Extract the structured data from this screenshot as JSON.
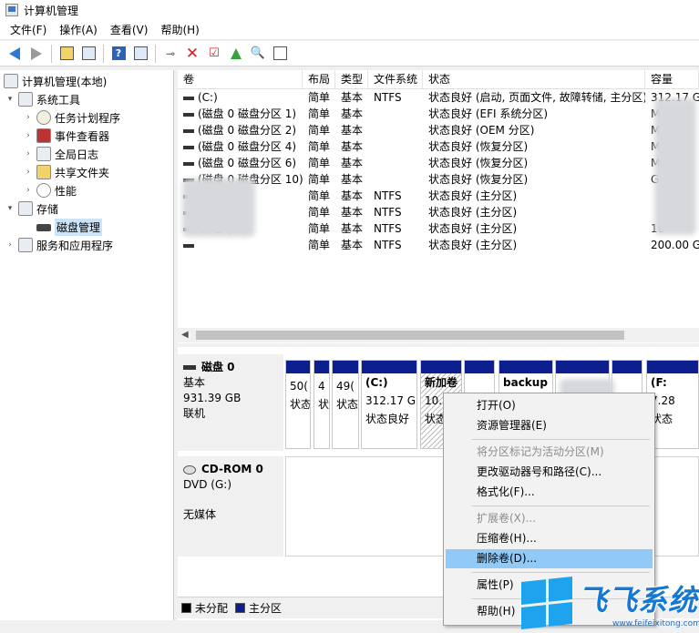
{
  "window": {
    "title": "计算机管理"
  },
  "menu": [
    "文件(F)",
    "操作(A)",
    "查看(V)",
    "帮助(H)"
  ],
  "tree": {
    "root": "计算机管理(本地)",
    "system_tools": "系统工具",
    "task_scheduler": "任务计划程序",
    "event_viewer": "事件查看器",
    "shared_folders_log": "全局日志",
    "shared_folders": "共享文件夹",
    "performance": "性能",
    "storage": "存储",
    "disk_management": "磁盘管理",
    "services": "服务和应用程序"
  },
  "volume_table": {
    "headers": [
      "卷",
      "布局",
      "类型",
      "文件系统",
      "状态",
      "容量"
    ],
    "rows": [
      {
        "vol": "(C:)",
        "layout": "简单",
        "type": "基本",
        "fs": "NTFS",
        "status": "状态良好 (启动, 页面文件, 故障转储, 主分区)",
        "cap": "312.17 G"
      },
      {
        "vol": "(磁盘 0 磁盘分区 1)",
        "layout": "简单",
        "type": "基本",
        "fs": "",
        "status": "状态良好 (EFI 系统分区)",
        "cap": "MB"
      },
      {
        "vol": "(磁盘 0 磁盘分区 2)",
        "layout": "简单",
        "type": "基本",
        "fs": "",
        "status": "状态良好 (OEM 分区)",
        "cap": "MB"
      },
      {
        "vol": "(磁盘 0 磁盘分区 4)",
        "layout": "简单",
        "type": "基本",
        "fs": "",
        "status": "状态良好 (恢复分区)",
        "cap": "MB"
      },
      {
        "vol": "(磁盘 0 磁盘分区 6)",
        "layout": "简单",
        "type": "基本",
        "fs": "",
        "status": "状态良好 (恢复分区)",
        "cap": "MB"
      },
      {
        "vol": "(磁盘 0 磁盘分区 10)",
        "layout": "简单",
        "type": "基本",
        "fs": "",
        "status": "状态良好 (恢复分区)",
        "cap": "GB"
      },
      {
        "vol": "",
        "layout": "简单",
        "type": "基本",
        "fs": "NTFS",
        "status": "状态良好 (主分区)",
        "cap": ""
      },
      {
        "vol": "",
        "layout": "简单",
        "type": "基本",
        "fs": "NTFS",
        "status": "状态良好 (主分区)",
        "cap": ""
      },
      {
        "vol": "新   卷 (H:)",
        "layout": "简单",
        "type": "基本",
        "fs": "NTFS",
        "status": "状态良好 (主分区)",
        "cap": "10"
      },
      {
        "vol": "",
        "layout": "简单",
        "type": "基本",
        "fs": "NTFS",
        "status": "状态良好 (主分区)",
        "cap": "200.00 G"
      }
    ]
  },
  "disk0": {
    "name": "磁盘 0",
    "kind": "基本",
    "size": "931.39 GB",
    "status": "联机",
    "parts": [
      {
        "l1": "",
        "l2": "",
        "l3": ""
      },
      {
        "l1": "",
        "l2": "",
        "l3": ""
      },
      {
        "l1": "",
        "l2": "",
        "l3": ""
      },
      {
        "l1": "",
        "l2": "50(",
        "l3": "状态"
      },
      {
        "l1": "",
        "l2": "4",
        "l3": "状"
      },
      {
        "l1": "",
        "l2": "49(",
        "l3": "状态"
      },
      {
        "l1": "(C:)",
        "l2": "312.17 G",
        "l3": "状态良好"
      },
      {
        "l1": "新加卷",
        "l2": "10.",
        "l3": "状态"
      },
      {
        "l1": "",
        "l2": "",
        "l3": ""
      },
      {
        "l1": "backup",
        "l2": "",
        "l3": ""
      },
      {
        "l1": "",
        "l2": "",
        "l3": ""
      },
      {
        "l1": "(F:",
        "l2": "7.28",
        "l3": "状态"
      }
    ]
  },
  "cdrom": {
    "name": "CD-ROM 0",
    "kind": "DVD (G:)",
    "status": "无媒体"
  },
  "legend": {
    "unallocated": "未分配",
    "primary": "主分区"
  },
  "context_menu": {
    "open": "打开(O)",
    "explorer": "资源管理器(E)",
    "mark_active": "将分区标记为活动分区(M)",
    "change_letter": "更改驱动器号和路径(C)...",
    "format": "格式化(F)...",
    "extend": "扩展卷(X)...",
    "shrink": "压缩卷(H)...",
    "delete": "删除卷(D)...",
    "properties": "属性(P)",
    "help": "帮助(H)"
  },
  "watermark": {
    "text": "飞飞系统",
    "url": "www.feifeixitong.com"
  },
  "colors": {
    "primary_partition": "#0d1e8e",
    "highlight": "#91c9f7",
    "watermark": "#1478d4"
  }
}
